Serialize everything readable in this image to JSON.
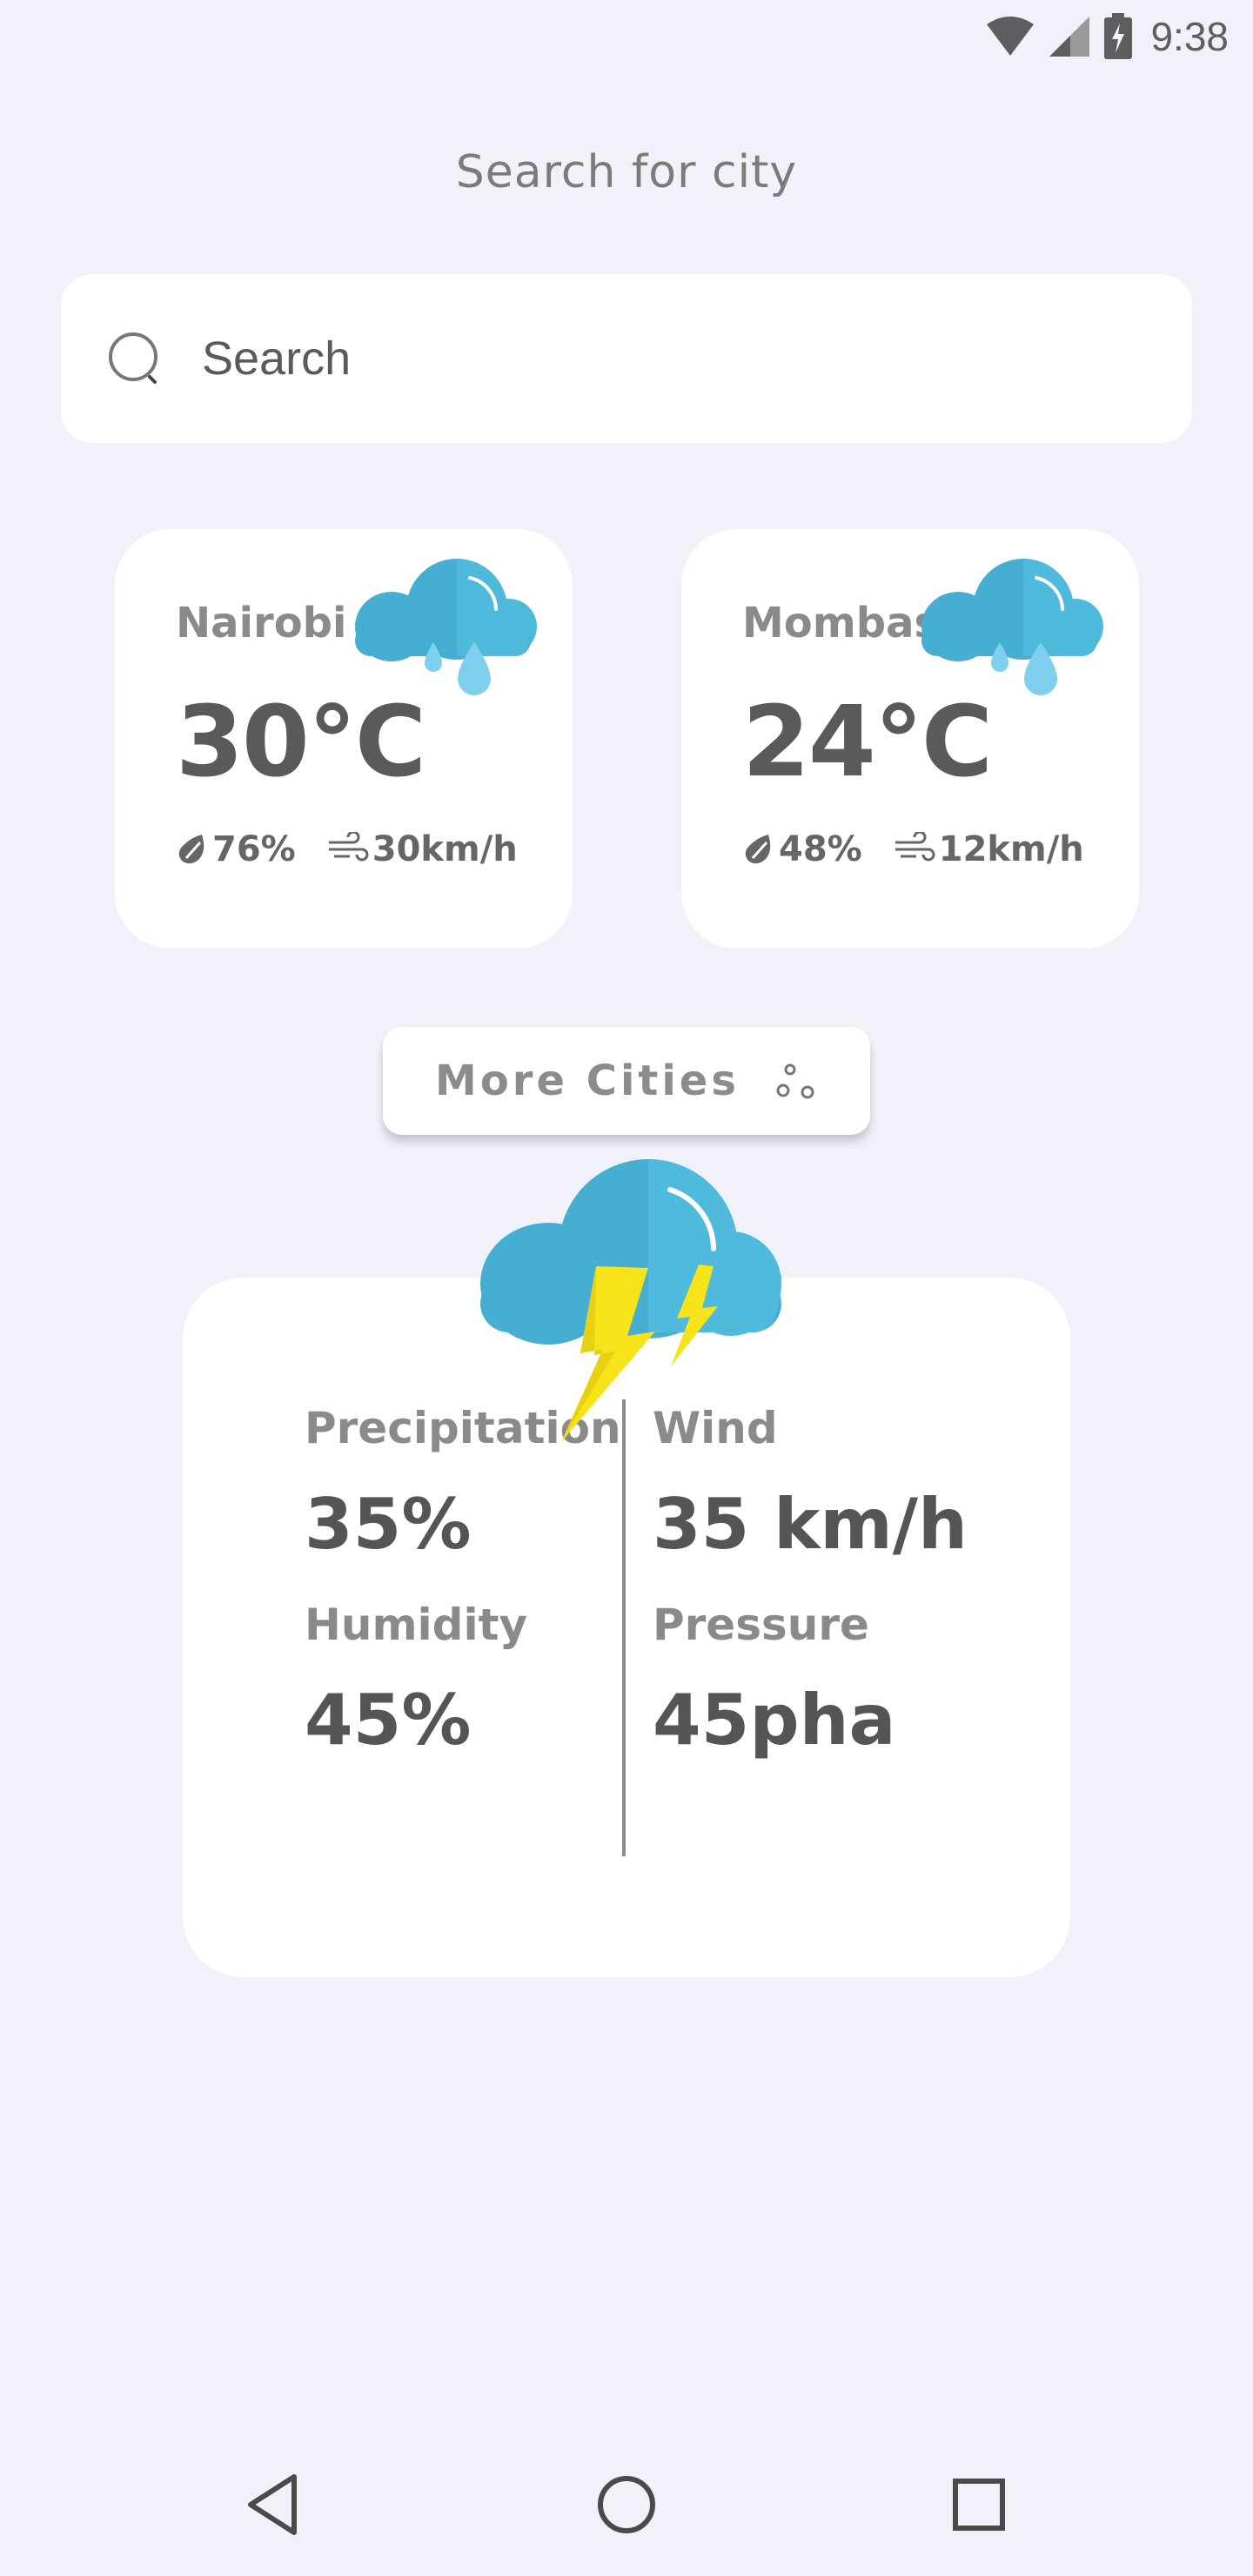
{
  "status_bar": {
    "time": "9:38"
  },
  "page": {
    "title": "Search for city"
  },
  "search": {
    "placeholder": "Search"
  },
  "cities": [
    {
      "name": "Nairobi",
      "temp": "30°C",
      "humidity": "76%",
      "wind": "30km/h"
    },
    {
      "name": "Mombasa",
      "temp": "24°C",
      "humidity": "48%",
      "wind": "12km/h"
    }
  ],
  "more_button": {
    "label": "More Cities"
  },
  "details": {
    "precipitation_label": "Precipitation",
    "precipitation_value": "35%",
    "humidity_label": "Humidity",
    "humidity_value": "45%",
    "wind_label": "Wind",
    "wind_value": "35 km/h",
    "pressure_label": "Pressure",
    "pressure_value": "45pha"
  },
  "colors": {
    "background": "#F0F1F9",
    "card": "#FFFFFF",
    "cloud": "#46AFD1",
    "raindrop": "#7ED0EE",
    "lightning": "#F6E418"
  },
  "icons": [
    "wifi-icon",
    "cell-signal-icon",
    "battery-icon",
    "search-icon",
    "rain-cloud-icon",
    "humidity-drop-icon",
    "wind-icon",
    "dots-icon",
    "storm-cloud-icon",
    "back-nav-icon",
    "home-nav-icon",
    "recents-nav-icon"
  ]
}
